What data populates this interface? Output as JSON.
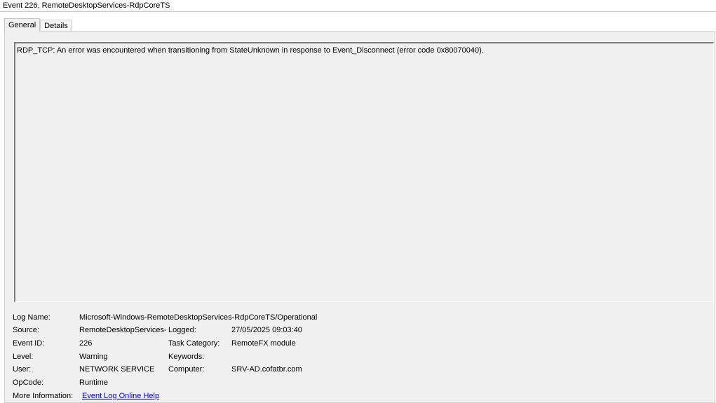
{
  "window": {
    "title": "Event 226, RemoteDesktopServices-RdpCoreTS"
  },
  "tabs": [
    {
      "label": "General",
      "active": true
    },
    {
      "label": "Details",
      "active": false
    }
  ],
  "description": "RDP_TCP: An error was encountered when transitioning from StateUnknown in response to Event_Disconnect (error code 0x80070040).",
  "fields": {
    "log_name": {
      "label": "Log Name:",
      "value": "Microsoft-Windows-RemoteDesktopServices-RdpCoreTS/Operational"
    },
    "source": {
      "label": "Source:",
      "value": "RemoteDesktopServices-RdpCoreTS"
    },
    "logged": {
      "label": "Logged:",
      "value": "27/05/2025 09:03:40"
    },
    "event_id": {
      "label": "Event ID:",
      "value": "226"
    },
    "task_category": {
      "label": "Task Category:",
      "value": "RemoteFX module"
    },
    "level": {
      "label": "Level:",
      "value": "Warning"
    },
    "keywords": {
      "label": "Keywords:",
      "value": ""
    },
    "user": {
      "label": "User:",
      "value": "NETWORK SERVICE"
    },
    "computer": {
      "label": "Computer:",
      "value": "SRV-AD.cofatbr.com"
    },
    "opcode": {
      "label": "OpCode:",
      "value": "Runtime"
    },
    "more_info": {
      "label": "More Information:",
      "link": "Event Log Online Help"
    }
  }
}
